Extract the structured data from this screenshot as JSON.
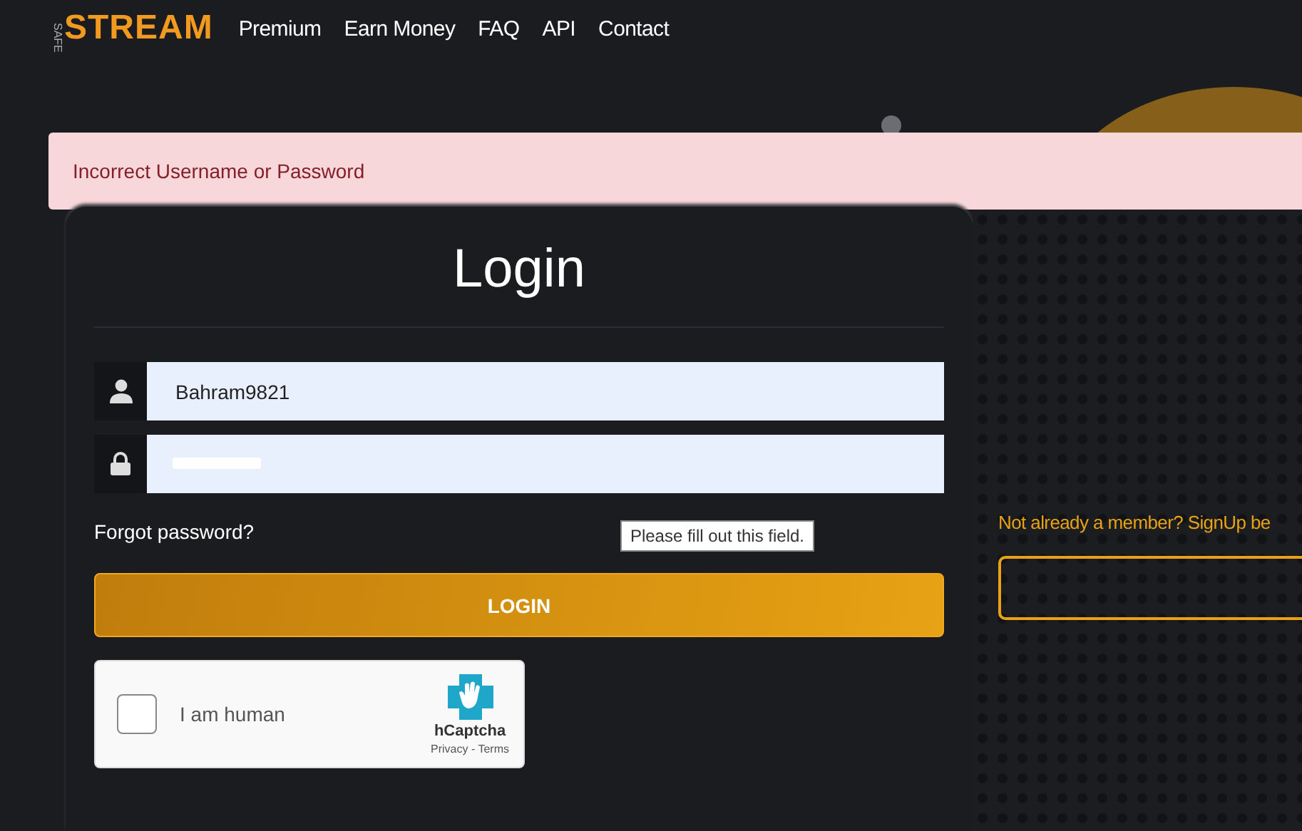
{
  "logo": {
    "small": "SAFE",
    "main": "STREAM"
  },
  "nav": [
    "Premium",
    "Earn Money",
    "FAQ",
    "API",
    "Contact"
  ],
  "alert": "Incorrect Username or Password",
  "login": {
    "title": "Login",
    "username": {
      "value": "Bahram9821"
    },
    "forgot": "Forgot password?",
    "tooltip": "Please fill out this field.",
    "button": "LOGIN",
    "captcha": {
      "label": "I am human",
      "checked": false,
      "brand": "hCaptcha",
      "links": "Privacy - Terms"
    }
  },
  "signup": {
    "text": "Not already a member? SignUp be"
  }
}
